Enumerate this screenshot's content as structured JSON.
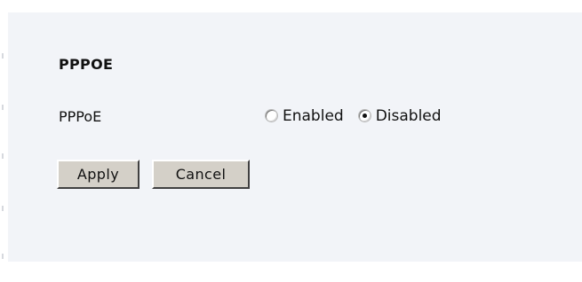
{
  "section": {
    "title": "PPPOE"
  },
  "pppoe_field": {
    "label": "PPPoE",
    "options": [
      {
        "label": "Enabled",
        "selected": false
      },
      {
        "label": "Disabled",
        "selected": true
      }
    ]
  },
  "actions": {
    "apply_label": "Apply",
    "cancel_label": "Cancel"
  },
  "colors": {
    "panel_background": "#f2f4f8",
    "button_face": "#d4d0c8"
  }
}
